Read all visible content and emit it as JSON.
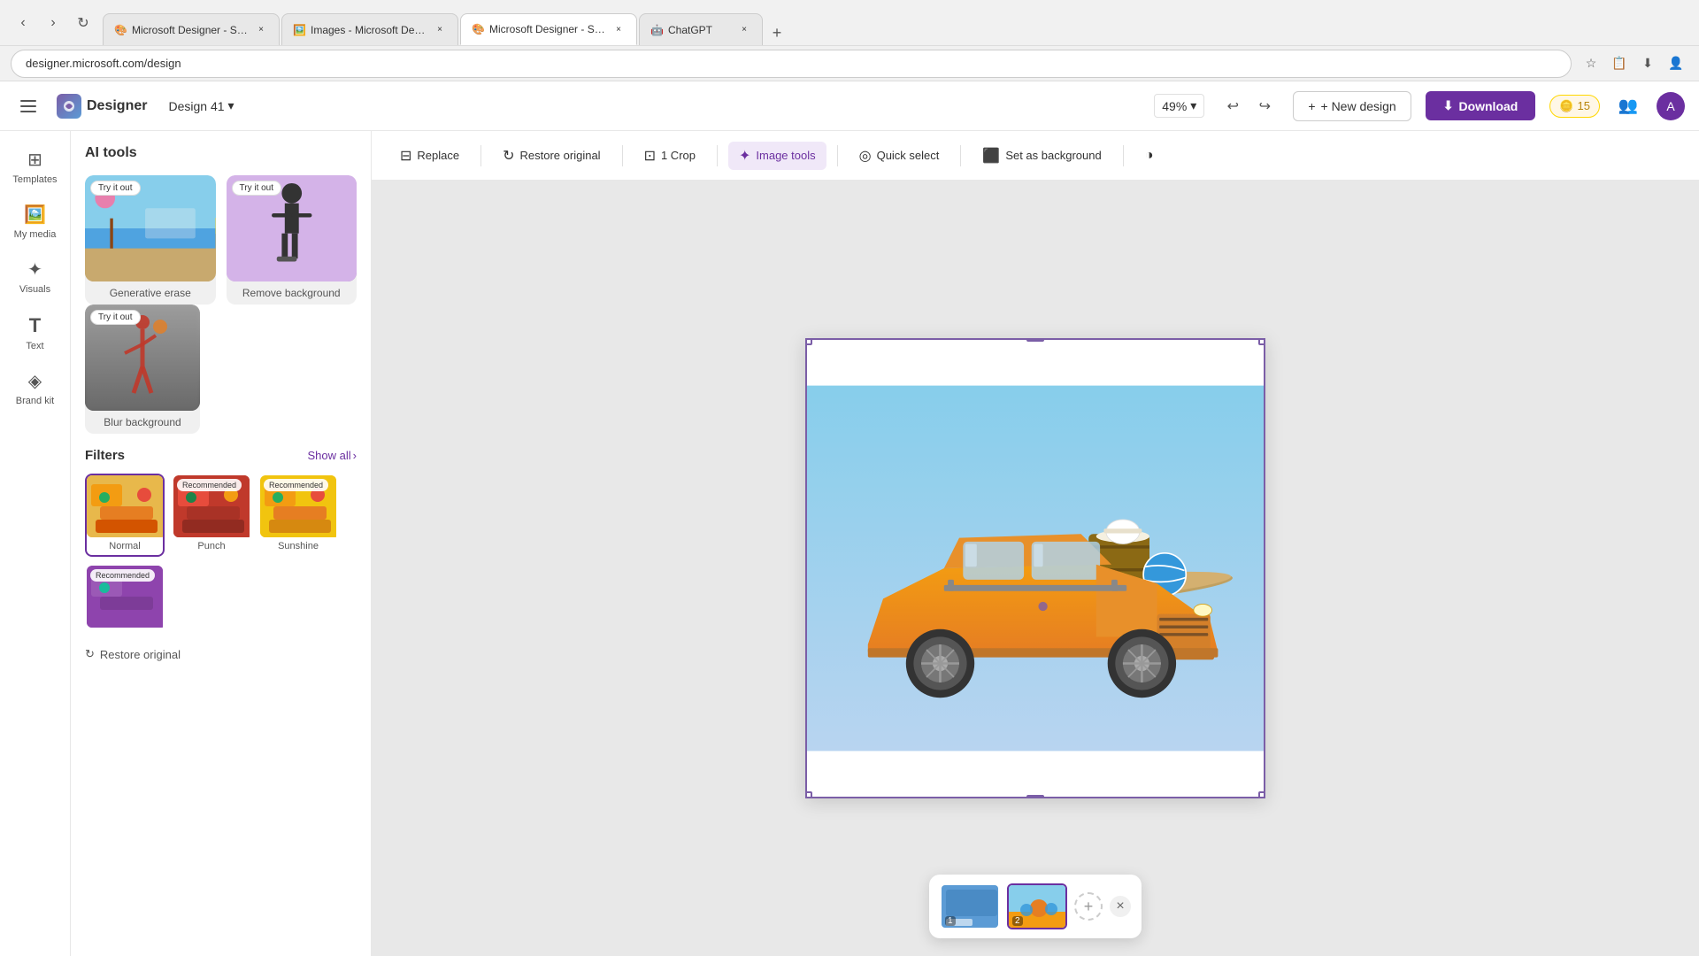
{
  "browser": {
    "tabs": [
      {
        "id": "tab1",
        "favicon": "🎨",
        "title": "Microsoft Designer - Stunning...",
        "active": false
      },
      {
        "id": "tab2",
        "favicon": "🖼️",
        "title": "Images - Microsoft Designer",
        "active": false
      },
      {
        "id": "tab3",
        "favicon": "🎨",
        "title": "Microsoft Designer - Stunning...",
        "active": true
      },
      {
        "id": "tab4",
        "favicon": "🤖",
        "title": "ChatGPT",
        "active": false
      }
    ],
    "url": "designer.microsoft.com/design",
    "zoom_label": "49%"
  },
  "topnav": {
    "app_name": "Designer",
    "design_name": "Design 41",
    "zoom": "49%",
    "new_design_label": "+ New design",
    "download_label": "Download",
    "coins": "15"
  },
  "sidebar": {
    "items": [
      {
        "id": "templates",
        "icon": "⊞",
        "label": "Templates"
      },
      {
        "id": "my-media",
        "icon": "🖼️",
        "label": "My media"
      },
      {
        "id": "visuals",
        "icon": "✦",
        "label": "Visuals"
      },
      {
        "id": "text",
        "icon": "T",
        "label": "Text"
      },
      {
        "id": "brand-kit",
        "icon": "◈",
        "label": "Brand kit"
      }
    ]
  },
  "panel": {
    "title": "AI tools",
    "tools": [
      {
        "id": "generative-erase",
        "label": "Generative erase",
        "has_badge": true
      },
      {
        "id": "remove-background",
        "label": "Remove background",
        "has_badge": true
      },
      {
        "id": "blur-background",
        "label": "Blur background",
        "has_badge": true
      }
    ],
    "filters_title": "Filters",
    "show_all_label": "Show all",
    "filters": [
      {
        "id": "normal",
        "label": "Normal",
        "selected": true,
        "recommended": false
      },
      {
        "id": "punch",
        "label": "Punch",
        "selected": false,
        "recommended": true
      },
      {
        "id": "sunshine",
        "label": "Sunshine",
        "selected": false,
        "recommended": true
      }
    ],
    "try_it_out": "Try it out",
    "restore_label": "Restore original"
  },
  "toolbar": {
    "replace_label": "Replace",
    "restore_label": "Restore original",
    "crop_label": "1 Crop",
    "image_tools_label": "Image tools",
    "quick_select_label": "Quick select",
    "set_as_bg_label": "Set as background"
  },
  "canvas": {
    "rotation_icon": "↻"
  },
  "slides": {
    "close_icon": "×",
    "add_icon": "+",
    "items": [
      {
        "id": "slide1",
        "num": "1",
        "active": false
      },
      {
        "id": "slide2",
        "num": "2",
        "active": true
      }
    ]
  }
}
